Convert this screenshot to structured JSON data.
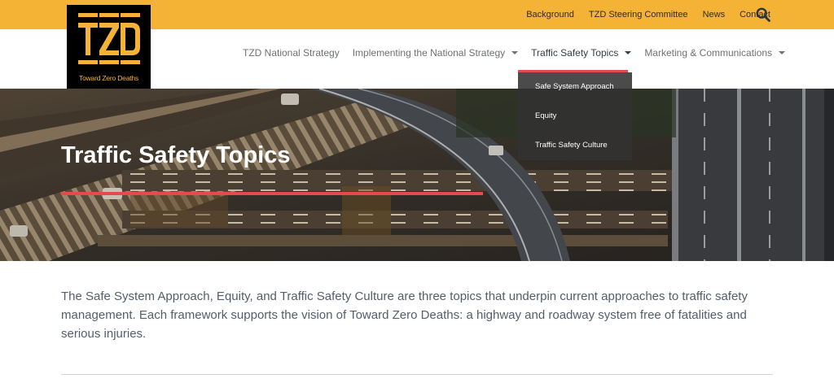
{
  "utility_nav": {
    "items": [
      "Background",
      "TZD Steering Committee",
      "News",
      "Contact"
    ],
    "search_icon": "search-icon"
  },
  "logo": {
    "mark": "TZD",
    "tagline": "Toward Zero Deaths"
  },
  "main_nav": {
    "items": [
      {
        "label": "TZD National Strategy"
      },
      {
        "label": "Implementing the National Strategy"
      },
      {
        "label": "Traffic Safety Topics"
      },
      {
        "label": "Marketing & Communications"
      }
    ],
    "active": "Traffic Safety Topics"
  },
  "dropdown": {
    "items": [
      "Safe System Approach",
      "Equity",
      "Traffic Safety Culture"
    ]
  },
  "hero": {
    "title": "Traffic Safety Topics"
  },
  "intro": {
    "text": "The Safe System Approach, Equity, and Traffic Safety Culture are three topics that underpin current approaches to traffic safety management. Each framework supports the vision of Toward Zero Deaths: a highway and roadway system free of fatalities and serious injuries."
  },
  "colors": {
    "topbar": "#f5b335",
    "accent": "#e8494c",
    "nav_text": "#6e7170",
    "body_text": "#545e6b"
  }
}
